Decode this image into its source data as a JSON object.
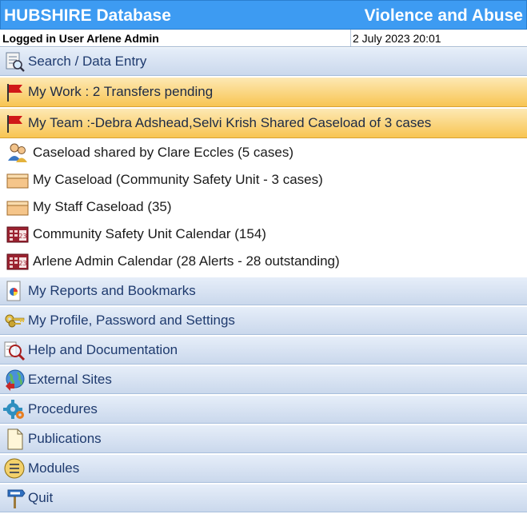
{
  "header": {
    "app_title": "HUBSHIRE Database",
    "module_title": "Violence and Abuse"
  },
  "userbar": {
    "user_text": "Logged in User Arlene Admin",
    "datetime": "2 July 2023 20:01"
  },
  "menu": {
    "search": {
      "label": "Search / Data Entry",
      "icon": "search-form-icon"
    },
    "my_work": {
      "label": "My Work : 2 Transfers pending",
      "icon": "red-flag-icon"
    },
    "my_team": {
      "label": "My Team :-Debra Adshead,Selvi Krish Shared Caseload of 3 cases",
      "icon": "red-flag-icon"
    },
    "caseloads": [
      {
        "label": "Caseload shared by Clare Eccles (5 cases)",
        "icon": "shared-users-icon"
      },
      {
        "label": "My Caseload (Community Safety Unit - 3 cases)",
        "icon": "folder-box-icon"
      },
      {
        "label": "My Staff Caseload (35)",
        "icon": "folder-box-icon"
      },
      {
        "label": "Community Safety Unit Calendar (154)",
        "icon": "calendar-icon"
      },
      {
        "label": "Arlene Admin Calendar (28 Alerts - 28 outstanding)",
        "icon": "calendar-icon"
      }
    ],
    "reports": {
      "label": "My Reports and Bookmarks",
      "icon": "report-chart-icon"
    },
    "profile": {
      "label": "My Profile, Password and Settings",
      "icon": "keys-icon"
    },
    "help": {
      "label": "Help and Documentation",
      "icon": "magnifier-document-icon"
    },
    "external": {
      "label": "External Sites",
      "icon": "globe-icon"
    },
    "procedures": {
      "label": "Procedures",
      "icon": "gear-icon"
    },
    "publications": {
      "label": "Publications",
      "icon": "document-icon"
    },
    "modules": {
      "label": "Modules",
      "icon": "list-circle-icon"
    },
    "quit": {
      "label": "Quit",
      "icon": "exit-sign-icon"
    }
  },
  "colors": {
    "header_bg": "#3d9bf2",
    "menu_bg": "#d6e2f2",
    "highlight_bg": "#f8c552",
    "flag_red": "#d01818"
  }
}
